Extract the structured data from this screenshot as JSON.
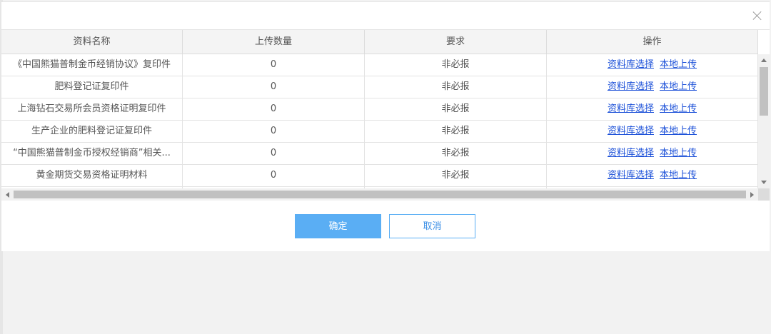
{
  "dialog": {
    "close_icon": "close-icon",
    "columns": [
      "资料名称",
      "上传数量",
      "要求",
      "操作"
    ],
    "rows": [
      {
        "name": "《中国熊猫普制金币经销协议》复印件",
        "count": "0",
        "requirement": "非必报",
        "action_select": "资料库选择",
        "action_upload": "本地上传"
      },
      {
        "name": "肥料登记证复印件",
        "count": "0",
        "requirement": "非必报",
        "action_select": "资料库选择",
        "action_upload": "本地上传"
      },
      {
        "name": "上海钻石交易所会员资格证明复印件",
        "count": "0",
        "requirement": "非必报",
        "action_select": "资料库选择",
        "action_upload": "本地上传"
      },
      {
        "name": "生产企业的肥料登记证复印件",
        "count": "0",
        "requirement": "非必报",
        "action_select": "资料库选择",
        "action_upload": "本地上传"
      },
      {
        "name": "“中国熊猫普制金币授权经销商”相关...",
        "count": "0",
        "requirement": "非必报",
        "action_select": "资料库选择",
        "action_upload": "本地上传"
      },
      {
        "name": "黄金期货交易资格证明材料",
        "count": "0",
        "requirement": "非必报",
        "action_select": "资料库选择",
        "action_upload": "本地上传"
      },
      {
        "name": "",
        "count": "",
        "requirement": "",
        "action_select": "",
        "action_upload": ""
      }
    ],
    "ok_label": "确定",
    "cancel_label": "取消"
  },
  "colors": {
    "primary": "#5aaef4",
    "link": "#1a4fd8",
    "header_bg": "#f4f4f4",
    "backdrop": "#f2f2f2"
  }
}
